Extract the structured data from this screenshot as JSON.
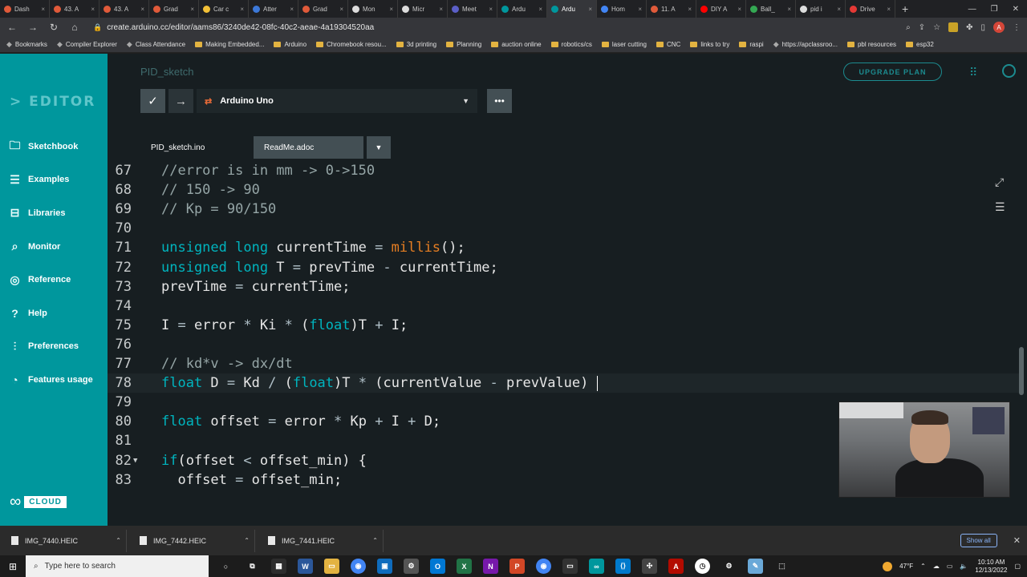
{
  "browser": {
    "tabs": [
      {
        "label": "Dash",
        "color": "#e05a3a"
      },
      {
        "label": "43. A",
        "color": "#e05a3a"
      },
      {
        "label": "43. A",
        "color": "#e05a3a"
      },
      {
        "label": "Grad",
        "color": "#e05a3a"
      },
      {
        "label": "Car c",
        "color": "#f2c037"
      },
      {
        "label": "Atter",
        "color": "#3c78d8"
      },
      {
        "label": "Grad",
        "color": "#e05a3a"
      },
      {
        "label": "Mon",
        "color": "#dddddd"
      },
      {
        "label": "Micr",
        "color": "#dddddd"
      },
      {
        "label": "Meet",
        "color": "#5b5fc7"
      },
      {
        "label": "Ardu",
        "color": "#00979d"
      },
      {
        "label": "Ardu",
        "color": "#00979d",
        "active": true
      },
      {
        "label": "Hom",
        "color": "#4285f4"
      },
      {
        "label": "11. A",
        "color": "#e05a3a"
      },
      {
        "label": "DIY A",
        "color": "#ff0000"
      },
      {
        "label": "Ball_",
        "color": "#34a853"
      },
      {
        "label": "pid i",
        "color": "#dddddd"
      },
      {
        "label": "Drive",
        "color": "#e53935"
      }
    ],
    "url": "create.arduino.cc/editor/aams86/3240de42-08fc-40c2-aeae-4a19304520aa",
    "bookmarks": [
      "Bookmarks",
      "Compiler Explorer",
      "Class Attendance",
      "Making Embedded...",
      "Arduino",
      "Chromebook resou...",
      "3d printing",
      "Planning",
      "auction online",
      "robotics/cs",
      "laser cutting",
      "CNC",
      "links to try",
      "raspi",
      "https://apclassroo...",
      "pbl resources",
      "esp32"
    ]
  },
  "sidebar": {
    "title": "> EDITOR",
    "items": [
      {
        "label": "Sketchbook",
        "icon": "folder-icon",
        "glyph": "🗀"
      },
      {
        "label": "Examples",
        "icon": "examples-icon",
        "glyph": "☰"
      },
      {
        "label": "Libraries",
        "icon": "libraries-icon",
        "glyph": "⊟"
      },
      {
        "label": "Monitor",
        "icon": "monitor-icon",
        "glyph": "⌕"
      },
      {
        "label": "Reference",
        "icon": "reference-icon",
        "glyph": "◎"
      },
      {
        "label": "Help",
        "icon": "help-icon",
        "glyph": "?"
      },
      {
        "label": "Preferences",
        "icon": "preferences-icon",
        "glyph": "⫶"
      },
      {
        "label": "Features usage",
        "icon": "features-icon",
        "glyph": "◔"
      }
    ],
    "cloud_label": "CLOUD"
  },
  "header": {
    "sketch_name": "PID_sketch",
    "upgrade_label": "UPGRADE PLAN"
  },
  "toolbar": {
    "board": "Arduino Uno"
  },
  "file_tabs": {
    "active": "PID_sketch.ino",
    "other": "ReadMe.adoc"
  },
  "code": {
    "current_line": 78,
    "lines": [
      {
        "n": 67,
        "tokens": [
          [
            "c-com",
            "//error is in mm -> 0->150"
          ]
        ]
      },
      {
        "n": 68,
        "tokens": [
          [
            "c-com",
            "// 150 -> 90"
          ]
        ]
      },
      {
        "n": 69,
        "tokens": [
          [
            "c-com",
            "// Kp = 90/150"
          ]
        ]
      },
      {
        "n": 70,
        "tokens": []
      },
      {
        "n": 71,
        "tokens": [
          [
            "c-kw",
            "unsigned long"
          ],
          [
            "c-id",
            " currentTime "
          ],
          [
            "c-op",
            "="
          ],
          [
            "c-id",
            " "
          ],
          [
            "c-fn",
            "millis"
          ],
          [
            "c-id",
            "();"
          ]
        ]
      },
      {
        "n": 72,
        "tokens": [
          [
            "c-kw",
            "unsigned long"
          ],
          [
            "c-id",
            " T "
          ],
          [
            "c-op",
            "="
          ],
          [
            "c-id",
            " prevTime "
          ],
          [
            "c-op",
            "-"
          ],
          [
            "c-id",
            " currentTime;"
          ]
        ]
      },
      {
        "n": 73,
        "tokens": [
          [
            "c-id",
            "prevTime "
          ],
          [
            "c-op",
            "="
          ],
          [
            "c-id",
            " currentTime;"
          ]
        ]
      },
      {
        "n": 74,
        "tokens": []
      },
      {
        "n": 75,
        "tokens": [
          [
            "c-id",
            "I "
          ],
          [
            "c-op",
            "="
          ],
          [
            "c-id",
            " error "
          ],
          [
            "c-op",
            "*"
          ],
          [
            "c-id",
            " Ki "
          ],
          [
            "c-op",
            "*"
          ],
          [
            "c-id",
            " ("
          ],
          [
            "c-kw",
            "float"
          ],
          [
            "c-id",
            ")T "
          ],
          [
            "c-op",
            "+"
          ],
          [
            "c-id",
            " I;"
          ]
        ]
      },
      {
        "n": 76,
        "tokens": []
      },
      {
        "n": 77,
        "tokens": [
          [
            "c-com",
            "// kd*v -> dx/dt"
          ]
        ]
      },
      {
        "n": 78,
        "tokens": [
          [
            "c-kw",
            "float"
          ],
          [
            "c-id",
            " D "
          ],
          [
            "c-op",
            "="
          ],
          [
            "c-id",
            " Kd "
          ],
          [
            "c-op",
            "/"
          ],
          [
            "c-id",
            " ("
          ],
          [
            "c-kw",
            "float"
          ],
          [
            "c-id",
            ")T "
          ],
          [
            "c-op",
            "*"
          ],
          [
            "c-id",
            " (currentValue "
          ],
          [
            "c-op",
            "-"
          ],
          [
            "c-id",
            " prevValue) "
          ]
        ]
      },
      {
        "n": 79,
        "tokens": []
      },
      {
        "n": 80,
        "tokens": [
          [
            "c-kw",
            "float"
          ],
          [
            "c-id",
            " offset "
          ],
          [
            "c-op",
            "="
          ],
          [
            "c-id",
            " error "
          ],
          [
            "c-op",
            "*"
          ],
          [
            "c-id",
            " Kp "
          ],
          [
            "c-op",
            "+"
          ],
          [
            "c-id",
            " I "
          ],
          [
            "c-op",
            "+"
          ],
          [
            "c-id",
            " D;"
          ]
        ]
      },
      {
        "n": 81,
        "tokens": []
      },
      {
        "n": 82,
        "fold": true,
        "tokens": [
          [
            "c-kw",
            "if"
          ],
          [
            "c-id",
            "(offset "
          ],
          [
            "c-op",
            "<"
          ],
          [
            "c-id",
            " offset_min) {"
          ]
        ]
      },
      {
        "n": 83,
        "tokens": [
          [
            "c-id",
            "  offset "
          ],
          [
            "c-op",
            "="
          ],
          [
            "c-id",
            " offset_min;"
          ]
        ]
      }
    ]
  },
  "downloads": {
    "files": [
      "IMG_7440.HEIC",
      "IMG_7442.HEIC",
      "IMG_7441.HEIC"
    ],
    "show_all": "Show all"
  },
  "taskbar": {
    "search_placeholder": "Type here to search",
    "temperature": "47°F",
    "time": "10:10 AM",
    "date": "12/13/2022"
  }
}
